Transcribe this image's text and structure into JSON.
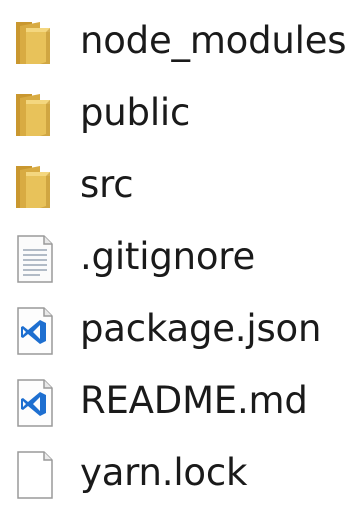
{
  "file_list": {
    "items": [
      {
        "label": "node_modules",
        "type": "folder",
        "icon": "folder-icon"
      },
      {
        "label": "public",
        "type": "folder",
        "icon": "folder-icon"
      },
      {
        "label": "src",
        "type": "folder",
        "icon": "folder-icon"
      },
      {
        "label": ".gitignore",
        "type": "text-file",
        "icon": "text-file-icon"
      },
      {
        "label": "package.json",
        "type": "vscode-file",
        "icon": "vscode-file-icon"
      },
      {
        "label": "README.md",
        "type": "vscode-file",
        "icon": "vscode-file-icon"
      },
      {
        "label": "yarn.lock",
        "type": "blank-file",
        "icon": "blank-file-icon"
      }
    ]
  },
  "colors": {
    "folder_front": "#e8c25a",
    "folder_back": "#c9972f",
    "vscode_blue": "#1e6fd0",
    "text": "#1a1a1a"
  }
}
